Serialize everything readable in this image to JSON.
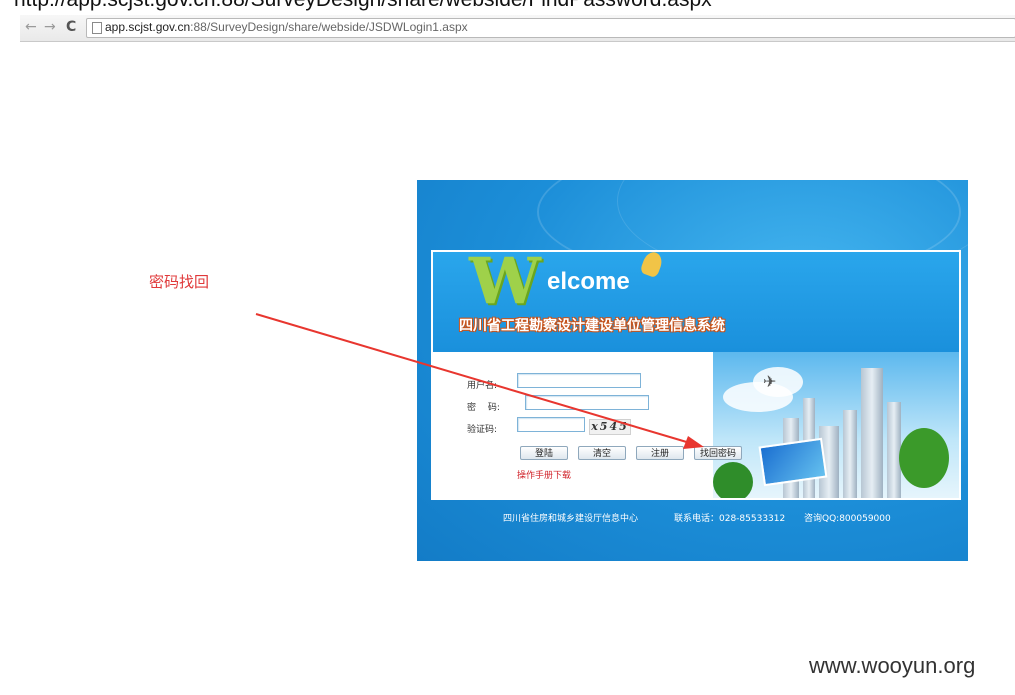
{
  "document": {
    "top_url_text": "http://app.scjst.gov.cn:88/SurveyDesign/share/webside/FindPassword.aspx"
  },
  "browser": {
    "back_icon": "arrow-left-icon",
    "forward_icon": "arrow-right-icon",
    "reload_icon": "reload-icon",
    "url_host": "app.scjst.gov.cn",
    "url_rest": ":88/SurveyDesign/share/webside/JSDWLogin1.aspx"
  },
  "annotation": {
    "label": "密码找回",
    "color": "#e0393a"
  },
  "login": {
    "welcome_w": "W",
    "welcome_rest": "elcome",
    "system_title": "四川省工程勘察设计建设单位管理信息系统",
    "username_label": "用户名:",
    "password_label": "密　 码:",
    "captcha_label": "验证码:",
    "captcha_text": "x545",
    "buttons": {
      "login": "登陆",
      "clear": "清空",
      "register": "注册",
      "find_password": "找回密码"
    },
    "manual_link": "操作手册下载",
    "footer_org": "四川省住房和城乡建设厅信息中心",
    "footer_phone": "联系电话：028-85533312",
    "footer_qq": "咨询QQ:800059000"
  },
  "watermark": "www.wooyun.org",
  "colors": {
    "panel_blue": "#1c8ed8",
    "title_orange": "#c7531a",
    "welcome_green": "#9fd14a",
    "link_red": "#d0232a"
  }
}
